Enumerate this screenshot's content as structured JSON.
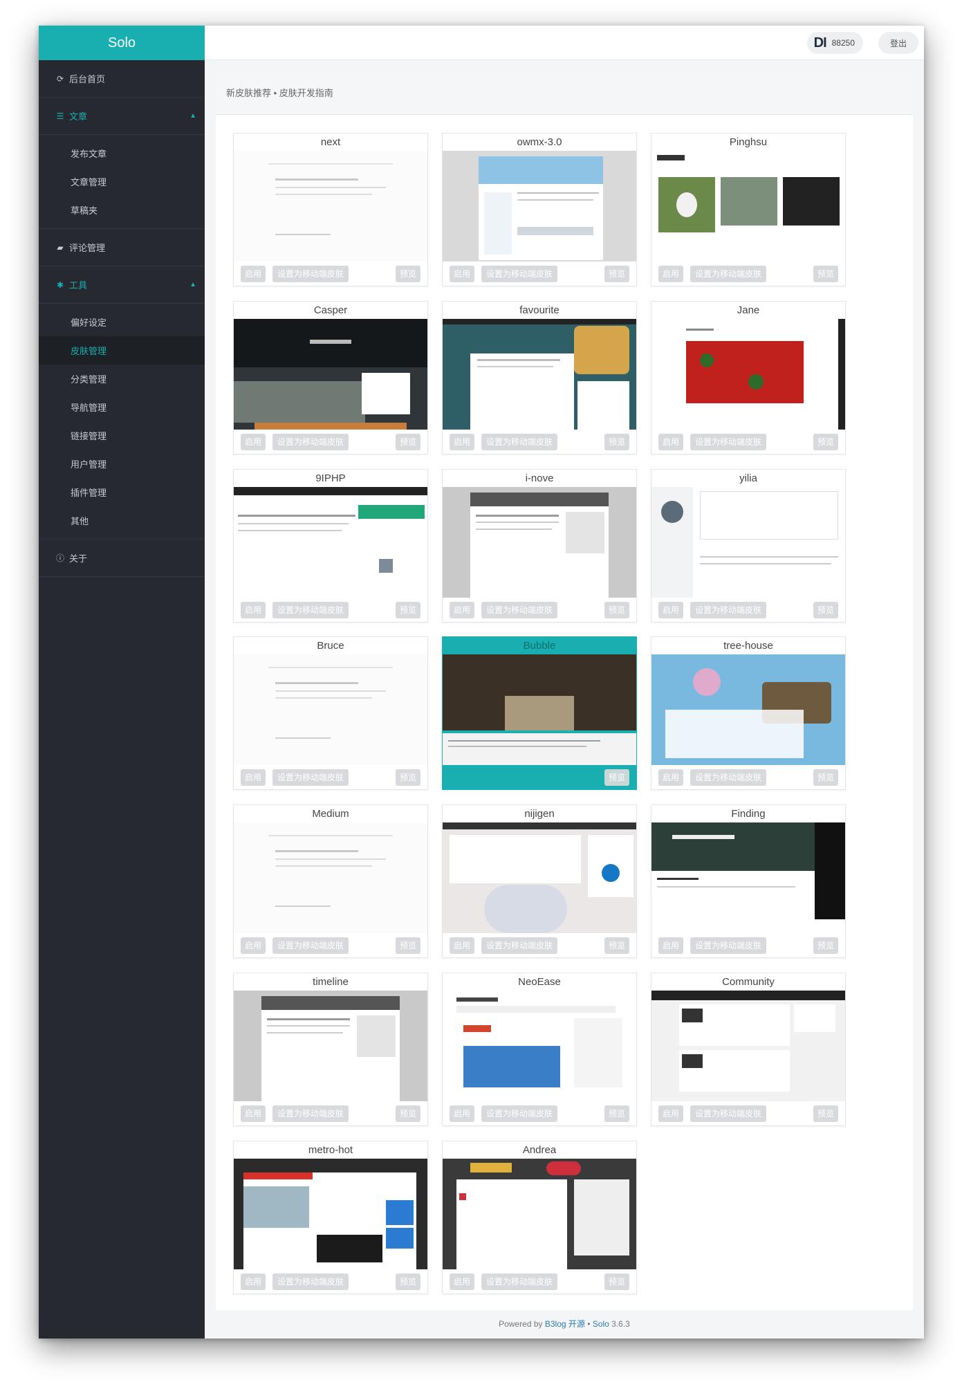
{
  "brand": "Solo",
  "sidebar": {
    "home": "后台首页",
    "articles": {
      "label": "文章",
      "items": [
        "发布文章",
        "文章管理",
        "草稿夹"
      ]
    },
    "comments": "评论管理",
    "tools": {
      "label": "工具",
      "items": [
        "偏好设定",
        "皮肤管理",
        "分类管理",
        "导航管理",
        "链接管理",
        "用户管理",
        "插件管理",
        "其他"
      ]
    },
    "about": "关于"
  },
  "topbar": {
    "avatar_text": "DI",
    "user_id": "88250",
    "logout": "登出"
  },
  "notice": "新皮肤推荐 • 皮肤开发指南",
  "buttons": {
    "enable": "启用",
    "mobile": "设置为移动端皮肤",
    "preview": "预览"
  },
  "skins": [
    {
      "name": "next",
      "style": "white"
    },
    {
      "name": "owmx-3.0",
      "style": "blue"
    },
    {
      "name": "Pinghsu",
      "style": "photos"
    },
    {
      "name": "Casper",
      "style": "dark"
    },
    {
      "name": "favourite",
      "style": "teal"
    },
    {
      "name": "Jane",
      "style": "flowers"
    },
    {
      "name": "9IPHP",
      "style": "light"
    },
    {
      "name": "i-nove",
      "style": "grey"
    },
    {
      "name": "yilia",
      "style": "profile"
    },
    {
      "name": "Bruce",
      "style": "white"
    },
    {
      "name": "Bubble",
      "style": "room",
      "current": true
    },
    {
      "name": "tree-house",
      "style": "sky"
    },
    {
      "name": "Medium",
      "style": "white"
    },
    {
      "name": "nijigen",
      "style": "anime"
    },
    {
      "name": "Finding",
      "style": "darkgreen"
    },
    {
      "name": "timeline",
      "style": "grey"
    },
    {
      "name": "NeoEase",
      "style": "blog"
    },
    {
      "name": "Community",
      "style": "community"
    },
    {
      "name": "metro-hot",
      "style": "metro"
    },
    {
      "name": "Andrea",
      "style": "andrea"
    }
  ],
  "footer": {
    "prefix": "Powered by ",
    "b3log": "B3log 开源",
    "sep": " • ",
    "solo": "Solo",
    "version": " 3.6.3"
  }
}
